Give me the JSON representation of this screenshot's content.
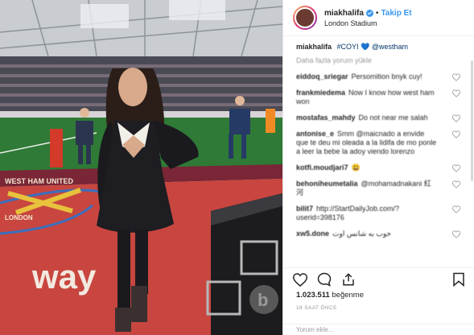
{
  "post": {
    "username": "miakhalifa",
    "follow_label": "Takip Et",
    "location": "London Stadium"
  },
  "caption": {
    "username": "miakhalifa",
    "hashtag": "#COYI",
    "extra": "💙",
    "mention": "@westham",
    "translate": "Daha fazla yorum yükle"
  },
  "comments": [
    {
      "user": "eiddoq_sriegar",
      "text": "Persomition bnyk cuy!"
    },
    {
      "user": "frankmiedema",
      "text": "Now I know how west ham won"
    },
    {
      "user": "mostafas_mahdy",
      "text": "Do not near me salah"
    },
    {
      "user": "antonise_e",
      "text": "Smm @maicnado a envide que te deu mi oleada a la lidifa de mo ponle a leer la bebe la adoy viendo lorenzo"
    },
    {
      "user": "kotfi.moudjari7",
      "text": "😃"
    },
    {
      "user": "behoniheumetalia",
      "text": "@mohamadnakani 紅河"
    },
    {
      "user": "bilit7",
      "text": "http://StartDailyJob.com/?userid=398176"
    },
    {
      "user": "xw5.done",
      "text": "خوب به شانس اوت"
    }
  ],
  "likes": {
    "count": "1.023.511",
    "label": "beğenme"
  },
  "timestamp": "18 SAAT ÖNCE",
  "add_comment_placeholder": "Yorum ekle...",
  "photo": {
    "board_text": "WEST HAM UNITED",
    "ad_text": "way",
    "crest_text": "LONDON",
    "watermark": "b"
  },
  "colors": {
    "accent": "#3897f0",
    "pitch": "#2f7a36",
    "track": "#c8463f",
    "claret": "#7a2636"
  }
}
